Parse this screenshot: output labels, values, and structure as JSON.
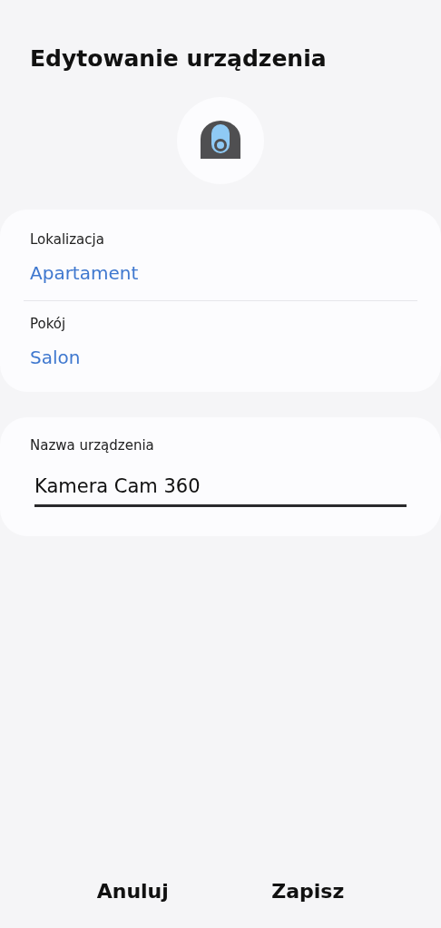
{
  "title": "Edytowanie urządzenia",
  "fields": [
    {
      "label": "Lokalizacja",
      "value": "Apartament"
    },
    {
      "label": "Pokój",
      "value": "Salon"
    }
  ],
  "name_field": {
    "label": "Nazwa urządzenia",
    "value": "Kamera Cam 360"
  },
  "buttons": [
    "Anuluj",
    "Zapisz"
  ]
}
